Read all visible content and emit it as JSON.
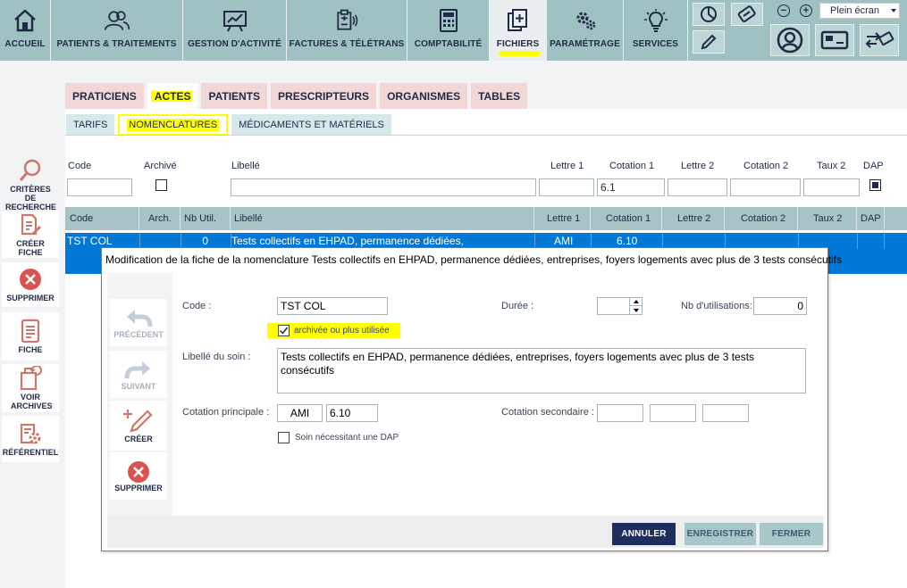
{
  "toolbar": {
    "nav": [
      {
        "id": "accueil",
        "label": "ACCUEIL",
        "icon": "home-icon"
      },
      {
        "id": "patients",
        "label": "PATIENTS & TRAITEMENTS",
        "icon": "users-icon"
      },
      {
        "id": "gestion",
        "label": "GESTION D'ACTIVITÉ",
        "icon": "chart-board-icon"
      },
      {
        "id": "factures",
        "label": "FACTURES & TÉLÉTRANS",
        "icon": "invoice-transmit-icon"
      },
      {
        "id": "comptabilite",
        "label": "COMPTABILITÉ",
        "icon": "calculator-icon"
      },
      {
        "id": "fichiers",
        "label": "FICHIERS",
        "icon": "files-add-icon"
      },
      {
        "id": "parametrage",
        "label": "PARAMÉTRAGE",
        "icon": "gears-icon"
      },
      {
        "id": "services",
        "label": "SERVICES",
        "icon": "lightbulb-icon"
      }
    ],
    "fullscreen_label": "Plein écran",
    "zoom_out": "−",
    "zoom_in": "+"
  },
  "tabs_main": [
    "PRATICIENS",
    "ACTES",
    "PATIENTS",
    "PRESCRIPTEURS",
    "ORGANISMES",
    "TABLES"
  ],
  "tabs_sub": [
    "TARIFS",
    "NOMENCLATURES",
    "MÉDICAMENTS ET MATÉRIELS"
  ],
  "sidebar": {
    "search": "CRITÈRES DE RECHERCHE",
    "create": "CRÉER FICHE",
    "delete": "SUPPRIMER",
    "sheet": "FICHE",
    "archives": "VOIR ARCHIVES",
    "ref": "RÉFÉRENTIEL"
  },
  "search": {
    "labels": {
      "code": "Code",
      "archive": "Archivé",
      "libelle": "Libellé",
      "lettre1": "Lettre 1",
      "cotation1": "Cotation 1",
      "lettre2": "Lettre 2",
      "cotation2": "Cotation 2",
      "taux2": "Taux 2",
      "dap": "DAP"
    },
    "cotation1_value": "6.1"
  },
  "table": {
    "headers": {
      "code": "Code",
      "arch": "Arch.",
      "nb": "Nb Util.",
      "libelle": "Libellé",
      "lettre1": "Lettre 1",
      "cotation1": "Cotation 1",
      "lettre2": "Lettre 2",
      "cotation2": "Cotation 2",
      "taux2": "Taux 2",
      "dap": "DAP"
    },
    "row": {
      "code": "TST COL",
      "nb": "0",
      "libelle": "Tests collectifs en EHPAD, permanence dédiées,",
      "lettre1": "AMI",
      "cotation1": "6.10"
    }
  },
  "modal": {
    "title": "Modification de la fiche de la nomenclature Tests collectifs en EHPAD, permanence dédiées, entreprises, foyers logements avec plus de 3 tests consécutifs",
    "left": {
      "prev": "PRÉCÉDENT",
      "next": "SUIVANT",
      "create": "CRÉER",
      "delete": "SUPPRIMER"
    },
    "code_label": "Code :",
    "code_value": "TST COL",
    "duree_label": "Durée :",
    "nb_label": "Nb d'utilisations:",
    "nb_value": "0",
    "archived_label": "archivée ou plus utilisée",
    "libelle_label": "Libellé du soin :",
    "libelle_value": "Tests collectifs en EHPAD, permanence dédiées, entreprises, foyers logements avec plus de 3 tests consécutifs",
    "cot_princ_label": "Cotation principale :",
    "cot_princ_letter": "AMI",
    "cot_princ_value": "6.10",
    "cot_sec_label": "Cotation secondaire :",
    "dap_label": "Soin nécessitant une DAP",
    "buttons": {
      "cancel": "ANNULER",
      "save": "ENREGISTRER",
      "close": "FERMER"
    }
  },
  "colors": {
    "toolbar": "#9fc1c2",
    "selected_row": "#0078d7",
    "highlight": "#ffff00",
    "cancel_btn": "#1c2f5e",
    "disabled_btn": "#a9c6c8",
    "danger": "#d9534f"
  }
}
